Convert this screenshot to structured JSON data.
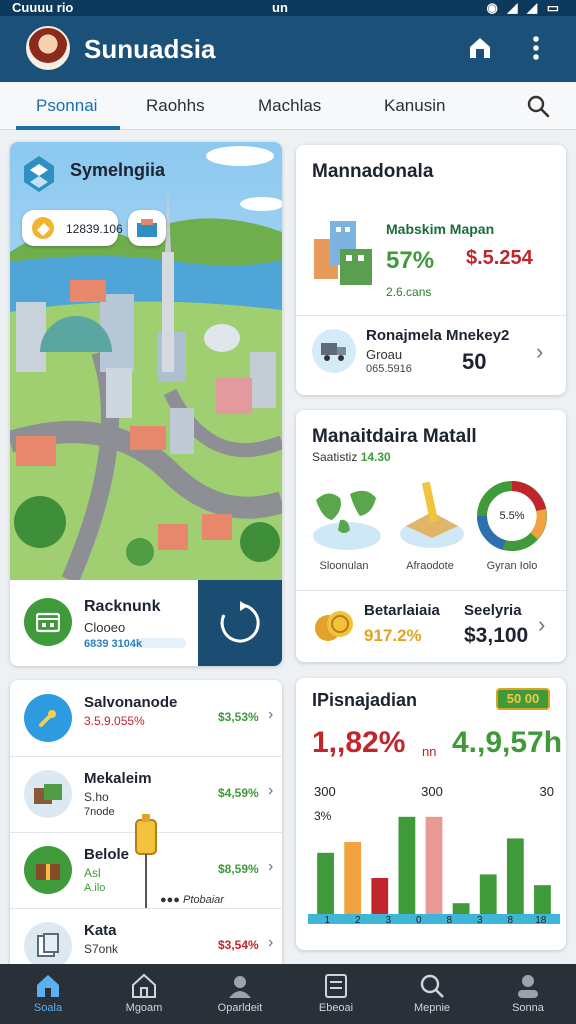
{
  "status_bar": {
    "left": "Cuuuu rio",
    "center": "un",
    "right": "◉ ◢ ◢ ▭"
  },
  "header": {
    "title": "Sunuadsia"
  },
  "tabs": [
    {
      "label": "Psonnai",
      "active": true
    },
    {
      "label": "Raohhs",
      "active": false
    },
    {
      "label": "Machlas",
      "active": false
    },
    {
      "label": "Kanusin",
      "active": false
    }
  ],
  "city_card": {
    "title": "Symelngiia",
    "pill_value": "12839.106",
    "label": "Racknunk",
    "sub": "Clooeo",
    "code": "6839 3104k"
  },
  "market_card": {
    "title": "Mannadonala",
    "sub": "Mabskim Mapan",
    "percent": "57%",
    "amount": "$.5.254",
    "small": "2.6.cans",
    "row_title": "Ronajmela Mnekey2",
    "row_sub": "Groau",
    "row_code": "065.5916",
    "row_value": "50"
  },
  "stats_card": {
    "title": "Manaitdaira Matall",
    "sub_label": "Saatistiz",
    "sub_value": "14.30",
    "donut_label": "5.5%",
    "captions": [
      "Sloonulan",
      "Afraodote",
      "Gyran Iolo"
    ],
    "left_title": "Betarlaiaia",
    "left_pct": "917.2%",
    "right_title": "Seelyria",
    "right_value": "$3,100"
  },
  "list_card": {
    "items": [
      {
        "title": "Salvonanode",
        "sub": "3.5.9.055%",
        "sub2": "",
        "value": "$3,53%",
        "value_color": "green"
      },
      {
        "title": "Mekaleim",
        "sub": "S.ho",
        "sub2": "7node",
        "value": "$4,59%",
        "value_color": "green"
      },
      {
        "title": "Belole",
        "sub": "Asl",
        "sub2": "A.ilo",
        "value": "$8,59%",
        "value_color": "green"
      },
      {
        "title": "Kata",
        "sub": "S7onk",
        "sub2": "",
        "value": "$3,54%",
        "value_color": "red"
      }
    ],
    "note": "●●● Ptobaiar"
  },
  "chart_card": {
    "title": "IPisnajadian",
    "badge": "50 00",
    "big_left": "1,,82%",
    "mid": "nn",
    "big_right": "4.,9,57h"
  },
  "chart_data": {
    "type": "bar",
    "y_labels_top": [
      "300",
      "300",
      "30"
    ],
    "y_label_second": "3%",
    "categories": [
      "1",
      "2",
      "3",
      "0",
      "8",
      "3",
      "8",
      "18"
    ],
    "series": [
      {
        "values": [
          17,
          20,
          10,
          27,
          27,
          3,
          11,
          21,
          8
        ]
      }
    ],
    "bar_colors": [
      "#3f9a3a",
      "#f2a340",
      "#c0262b",
      "#3f9a3a",
      "#e99a94",
      "#3f9a3a",
      "#3f9a3a",
      "#3f9a3a",
      "#3f9a3a"
    ],
    "ylim": [
      0,
      30
    ]
  },
  "bottom_nav": [
    {
      "label": "Soala",
      "icon": "home-icon",
      "active": true
    },
    {
      "label": "Mgoam",
      "icon": "house-outline-icon",
      "active": false
    },
    {
      "label": "Oparldeit",
      "icon": "person-card-icon",
      "active": false
    },
    {
      "label": "Ebeoai",
      "icon": "document-icon",
      "active": false
    },
    {
      "label": "Mepnie",
      "icon": "search-icon",
      "active": false
    },
    {
      "label": "Sonna",
      "icon": "profile-icon",
      "active": false
    }
  ]
}
